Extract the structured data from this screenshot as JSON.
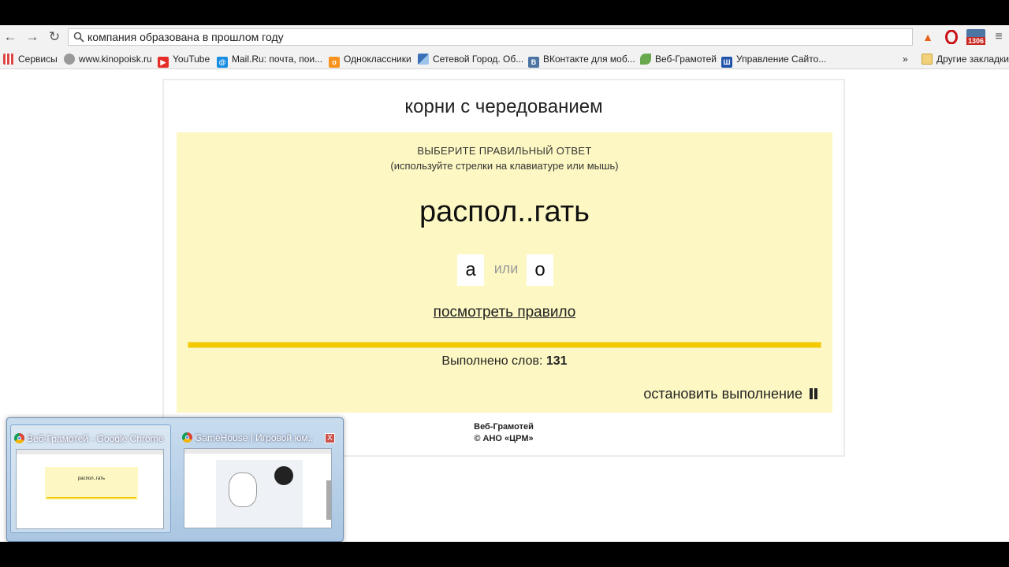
{
  "toolbar": {
    "back_icon": "arrow-left-icon",
    "forward_icon": "arrow-right-icon",
    "reload_icon": "reload-icon",
    "omnibox_text": "компания образована в прошлом году",
    "ext_vk_badge": "1306"
  },
  "bookmarks": [
    {
      "label": "Сервисы",
      "icon": "apps-grid-icon",
      "color": "#d44"
    },
    {
      "label": "www.kinopoisk.ru",
      "icon": "film-reel-icon",
      "color": "#888"
    },
    {
      "label": "YouTube",
      "icon": "youtube-icon",
      "color": "#e52d27"
    },
    {
      "label": "Mail.Ru: почта, пои...",
      "icon": "at-sign-icon",
      "color": "#168de2"
    },
    {
      "label": "Одноклассники",
      "icon": "odnoklassniki-icon",
      "color": "#f7931e"
    },
    {
      "label": "Сетевой Город. Об...",
      "icon": "network-city-icon",
      "color": "#3b6fb6"
    },
    {
      "label": "ВКонтакте для моб...",
      "icon": "vk-icon",
      "color": "#4c75a3"
    },
    {
      "label": "Веб-Грамотей",
      "icon": "leaf-icon",
      "color": "#6aa84f"
    },
    {
      "label": "Управление Сайто...",
      "icon": "site-manage-icon",
      "color": "#2255aa"
    }
  ],
  "bookmarks_more": "»",
  "other_bookmarks": "Другие закладки",
  "page": {
    "title": "корни с чередованием",
    "instruction_main": "ВЫБЕРИТЕ ПРАВИЛЬНЫЙ ОТВЕТ",
    "instruction_hint": "(используйте стрелки на клавиатуре или мышь)",
    "word": "распол..гать",
    "choice_a": "а",
    "or_text": "или",
    "choice_b": "о",
    "rule_link": "посмотреть правило",
    "progress_fraction": 1.0,
    "done_label": "Выполнено слов:",
    "done_count": "131",
    "stop_label": "остановить выполнение",
    "footer_name": "Веб-Грамотей",
    "footer_copy": "© АНО «ЦРМ»"
  },
  "taskbar_preview": {
    "windows": [
      {
        "title": "Веб-Грамотей - Google Chrome",
        "thumb_word": "распол..гать"
      },
      {
        "title": "GameHouse | Игровой юм..."
      }
    ],
    "close_label": "X"
  },
  "colors": {
    "quiz_bg": "#fdf8c3",
    "progress": "#f4c900"
  }
}
